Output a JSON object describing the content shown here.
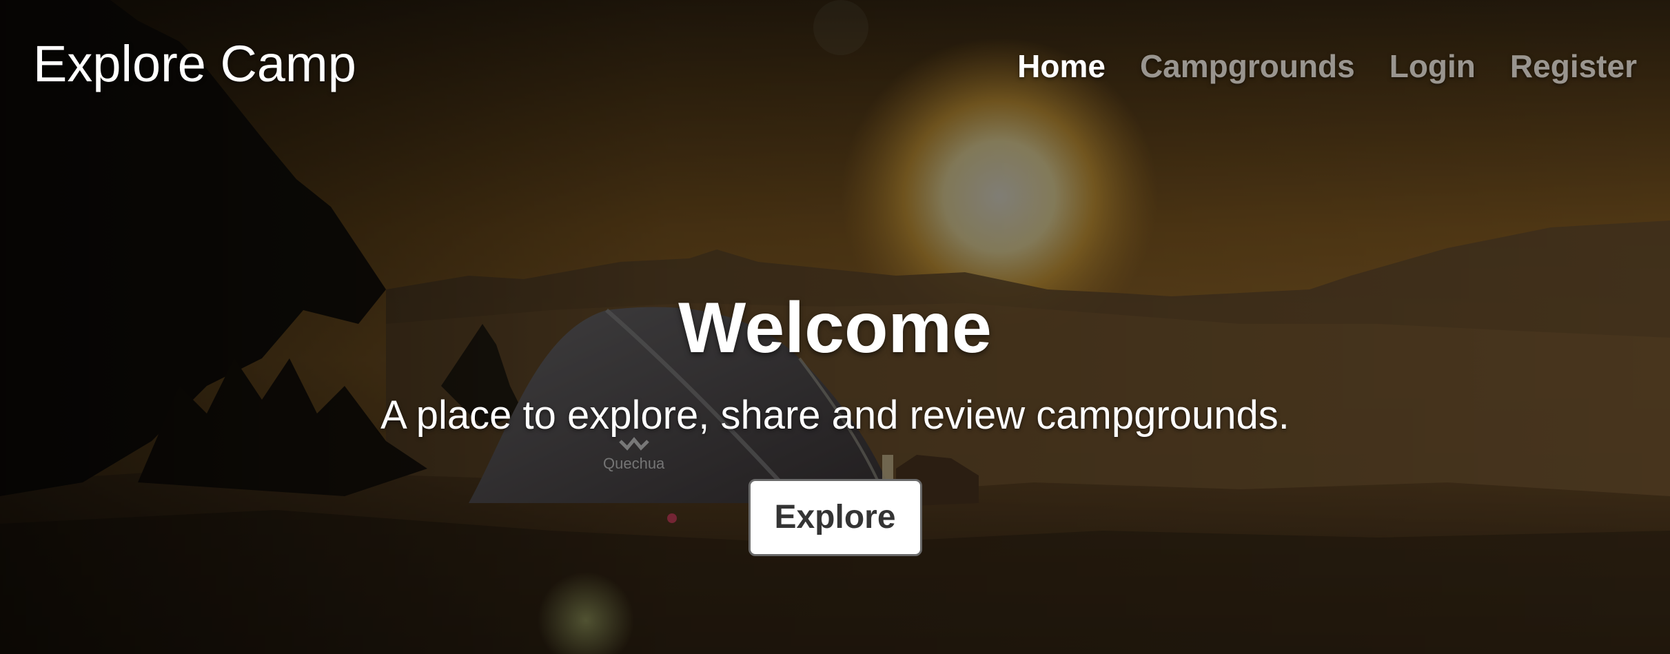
{
  "navbar": {
    "brand": "Explore Camp",
    "links": [
      {
        "label": "Home",
        "active": true
      },
      {
        "label": "Campgrounds",
        "active": false
      },
      {
        "label": "Login",
        "active": false
      },
      {
        "label": "Register",
        "active": false
      }
    ]
  },
  "hero": {
    "title": "Welcome",
    "subtitle": "A place to explore, share and review campgrounds.",
    "button_label": "Explore",
    "tent_brand": "Quechua"
  },
  "colors": {
    "text_primary": "#ffffff",
    "text_muted": "rgba(255,255,255,0.55)",
    "button_text": "#343434",
    "button_border": "#6a6a6a",
    "overlay": "rgba(0,0,0,0.5)"
  }
}
